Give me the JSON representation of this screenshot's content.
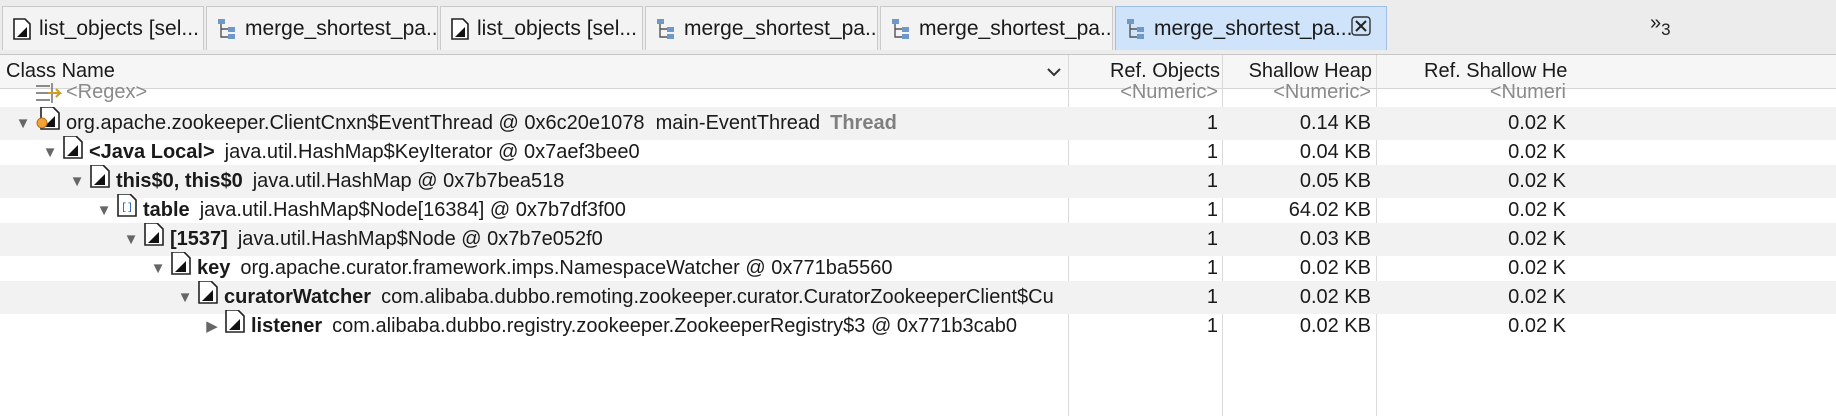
{
  "tabs": [
    {
      "label": "list_objects [sel...",
      "icon": "document-icon"
    },
    {
      "label": "merge_shortest_pa...",
      "icon": "tree-icon"
    },
    {
      "label": "list_objects [sel...",
      "icon": "document-icon"
    },
    {
      "label": "merge_shortest_pa...",
      "icon": "tree-icon"
    },
    {
      "label": "merge_shortest_pa...",
      "icon": "tree-icon"
    },
    {
      "label": "merge_shortest_pa...",
      "icon": "tree-icon",
      "active": true
    }
  ],
  "overflow": {
    "chevron": "»",
    "count": "3"
  },
  "columns": {
    "class_name": "Class Name",
    "ref_objects": "Ref. Objects",
    "shallow_heap": "Shallow Heap",
    "ref_shallow_heap": "Ref. Shallow He"
  },
  "filter_row": {
    "regex": "<Regex>",
    "ref_objects": "<Numeric>",
    "shallow_heap": "<Numeric>",
    "ref_shallow_heap": "<Numeri"
  },
  "rows": [
    {
      "twisty": "▼",
      "name": "",
      "text": "org.apache.zookeeper.ClientCnxn$EventThread @ 0x6c20e1078  main-EventThread",
      "tag": "Thread",
      "ref_objects": "1",
      "shallow_heap": "0.14 KB",
      "ref_shallow_heap": "0.02 K",
      "icon": "object-icon"
    },
    {
      "twisty": "▼",
      "name": "<Java Local>",
      "text": "java.util.HashMap$KeyIterator @ 0x7aef3bee0",
      "tag": "",
      "ref_objects": "1",
      "shallow_heap": "0.04 KB",
      "ref_shallow_heap": "0.02 K",
      "icon": "object-icon"
    },
    {
      "twisty": "▼",
      "name": "this$0, this$0",
      "text": "java.util.HashMap @ 0x7b7bea518",
      "tag": "",
      "ref_objects": "1",
      "shallow_heap": "0.05 KB",
      "ref_shallow_heap": "0.02 K",
      "icon": "object-icon"
    },
    {
      "twisty": "▼",
      "name": "table",
      "text": "java.util.HashMap$Node[16384] @ 0x7b7df3f00",
      "tag": "",
      "ref_objects": "1",
      "shallow_heap": "64.02 KB",
      "ref_shallow_heap": "0.02 K",
      "icon": "array-icon"
    },
    {
      "twisty": "▼",
      "name": "[1537]",
      "text": "java.util.HashMap$Node @ 0x7b7e052f0",
      "tag": "",
      "ref_objects": "1",
      "shallow_heap": "0.03 KB",
      "ref_shallow_heap": "0.02 K",
      "icon": "object-icon"
    },
    {
      "twisty": "▼",
      "name": "key",
      "text": "org.apache.curator.framework.imps.NamespaceWatcher @ 0x771ba5560",
      "tag": "",
      "ref_objects": "1",
      "shallow_heap": "0.02 KB",
      "ref_shallow_heap": "0.02 K",
      "icon": "object-icon"
    },
    {
      "twisty": "▼",
      "name": "curatorWatcher",
      "text": "com.alibaba.dubbo.remoting.zookeeper.curator.CuratorZookeeperClient$Cu",
      "tag": "",
      "ref_objects": "1",
      "shallow_heap": "0.02 KB",
      "ref_shallow_heap": "0.02 K",
      "icon": "object-icon"
    },
    {
      "twisty": "▶",
      "name": "listener",
      "text": "com.alibaba.dubbo.registry.zookeeper.ZookeeperRegistry$3 @ 0x771b3cab0",
      "tag": "",
      "ref_objects": "1",
      "shallow_heap": "0.02 KB",
      "ref_shallow_heap": "0.02 K",
      "icon": "object-icon"
    }
  ]
}
